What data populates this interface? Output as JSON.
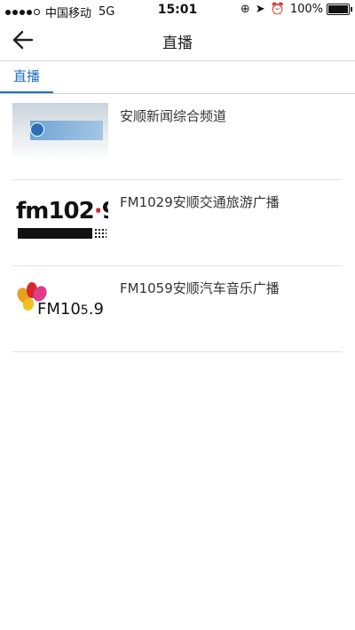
{
  "status_bar": {
    "carrier": "中国移动",
    "network": "5G",
    "time": "15:01",
    "battery": "100%"
  },
  "nav": {
    "title": "直播",
    "back_icon": "back-arrow-icon"
  },
  "tabs": [
    {
      "label": "直播",
      "selected": true
    }
  ],
  "channels": [
    {
      "title": "安顺新闻综合频道",
      "thumb_icon": "news-channel-logo"
    },
    {
      "title": "FM1029安顺交通旅游广播",
      "thumb_icon": "fm1029-logo"
    },
    {
      "title": "FM1059安顺汽车音乐广播",
      "thumb_icon": "fm1059-logo"
    }
  ],
  "colors": {
    "accent": "#1e6fc9"
  }
}
